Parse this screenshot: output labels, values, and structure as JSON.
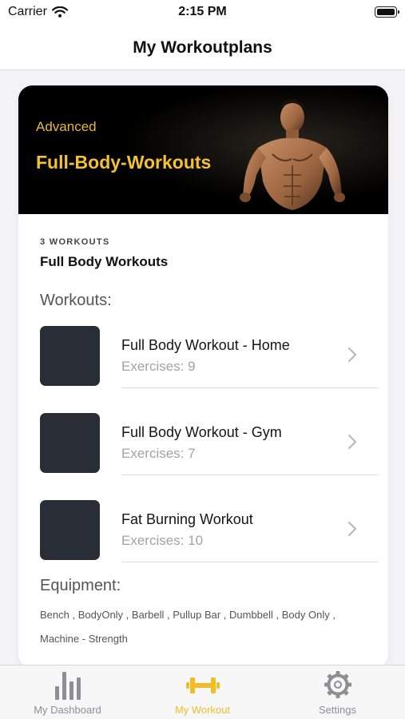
{
  "status_bar": {
    "carrier": "Carrier",
    "time": "2:15 PM"
  },
  "nav": {
    "title": "My Workoutplans"
  },
  "plan": {
    "level": "Advanced",
    "hero_title": "Full-Body-Workouts",
    "count_label": "3 WORKOUTS",
    "name": "Full Body Workouts",
    "workouts_heading": "Workouts:",
    "workouts": [
      {
        "title": "Full Body Workout - Home",
        "exercises": "Exercises: 9"
      },
      {
        "title": "Full Body Workout - Gym",
        "exercises": "Exercises: 7"
      },
      {
        "title": "Fat Burning Workout",
        "exercises": "Exercises: 10"
      }
    ],
    "equipment_heading": "Equipment:",
    "equipment": "Bench , BodyOnly , Barbell , Pullup Bar , Dumbbell , Body Only , Machine - Strength"
  },
  "tabs": [
    {
      "label": "My Dashboard",
      "icon": "bar-chart-icon",
      "active": false
    },
    {
      "label": "My Workout",
      "icon": "dumbbell-icon",
      "active": true
    },
    {
      "label": "Settings",
      "icon": "gear-icon",
      "active": false
    }
  ],
  "colors": {
    "accent": "#f0bd25",
    "tab_inactive": "#8e8e93",
    "thumb": "#282d36",
    "hero_bg": "#000000"
  }
}
